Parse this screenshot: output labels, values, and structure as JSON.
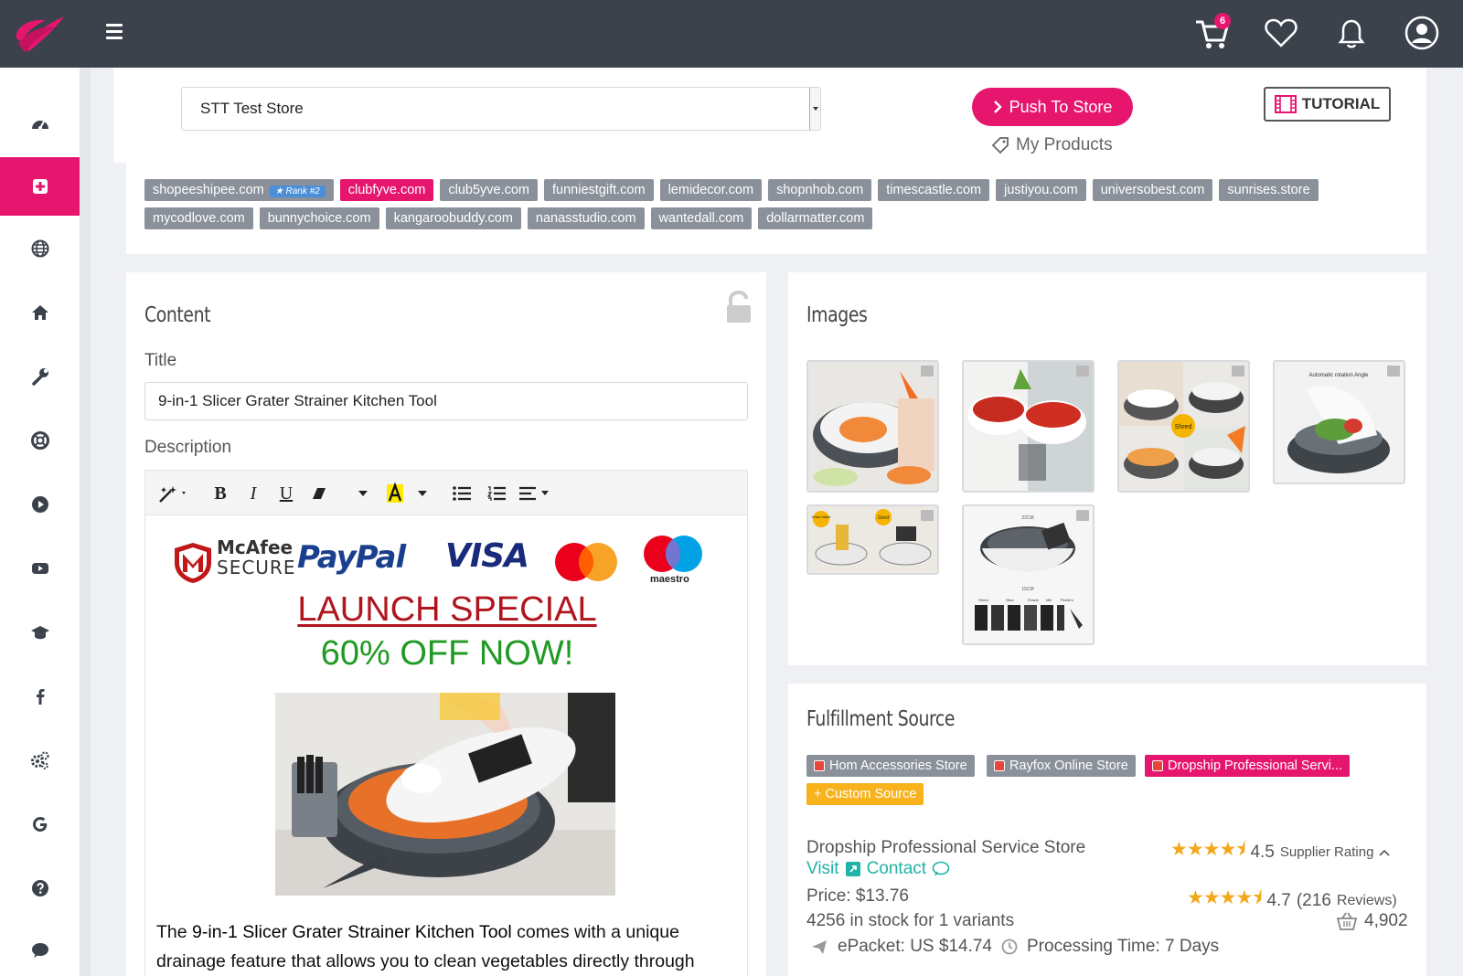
{
  "header": {
    "cart_count": "6",
    "icons": [
      "menu-icon",
      "cart-icon",
      "heart-icon",
      "bell-icon",
      "user-icon"
    ]
  },
  "sidebar": {
    "items": [
      {
        "icon": "dashboard-icon"
      },
      {
        "icon": "import-icon",
        "active": true
      },
      {
        "icon": "globe-icon"
      },
      {
        "icon": "home-icon"
      },
      {
        "icon": "wrench-icon"
      },
      {
        "icon": "support-icon"
      },
      {
        "icon": "play-icon"
      },
      {
        "icon": "youtube-icon"
      },
      {
        "icon": "graduation-cap-icon"
      },
      {
        "icon": "facebook-icon"
      },
      {
        "icon": "settings-icon"
      },
      {
        "icon": "google-icon"
      },
      {
        "icon": "help-icon"
      },
      {
        "icon": "chat-icon"
      }
    ],
    "accent": "#e6166f"
  },
  "store_bar": {
    "store_select": "STT Test Store",
    "push_label": "Push To Store",
    "my_products_label": "My Products",
    "tutorial_label": "TUTORIAL"
  },
  "domains": {
    "row1": [
      "shopeeshipee.com",
      "clubfyve.com",
      "club5yve.com",
      "funniestgift.com",
      "lemidecor.com",
      "shopnhob.com",
      "timescastle.com",
      "justiyou.com",
      "universobest.com",
      "sunrises.store"
    ],
    "row2": [
      "mycodlove.com",
      "bunnychoice.com",
      "kangaroobuddy.com",
      "nanasstudio.com",
      "wantedall.com",
      "dollarmatter.com"
    ],
    "rank_label": "Rank #2",
    "active": "clubfyve.com"
  },
  "content": {
    "heading": "Content",
    "title_label": "Title",
    "title_value": "9-in-1 Slicer Grater Strainer Kitchen Tool",
    "description_label": "Description",
    "logos": {
      "mcafee_line1": "McAfee",
      "mcafee_line2": "SECURE",
      "paypal": "PayPal",
      "visa": "VISA",
      "maestro": "maestro"
    },
    "launch_line1": "LAUNCH SPECIAL",
    "launch_line2": "60% OFF NOW!",
    "desc_prefix": "The ",
    "desc_bold": "9-in-1 Slicer Grater Strainer Kitchen Tool",
    "desc_suffix": " comes with a unique drainage feature that allows you to clean vegetables directly through",
    "colors": {
      "launch_red": "#b0151e",
      "launch_green": "#1f9a22"
    }
  },
  "images": {
    "heading": "Images",
    "thumb_texts": [
      "Shred",
      "Automatic rotation Angle",
      "Grate blade",
      "Grind",
      "22CM",
      "15CM",
      "Shred",
      "Slice",
      "Flower",
      "Mill",
      "Peelers"
    ]
  },
  "fulfillment": {
    "heading": "Fulfillment Source",
    "sources": [
      "Hom Accessories Store",
      "Rayfox Online Store",
      "Dropship Professional Servi..."
    ],
    "custom_source": "+ Custom Source",
    "store_name": "Dropship Professional Service Store",
    "supplier_rating": "4.5",
    "supplier_rating_label": "Supplier Rating",
    "visit_label": "Visit",
    "contact_label": "Contact",
    "product_rating": "4.7",
    "reviews_count": "(216",
    "reviews_label": "Reviews)",
    "price": "Price: $13.76",
    "stock": "4256 in stock for 1 variants",
    "orders": "4,902",
    "shipping": "ePacket: US $14.74",
    "processing": "Processing Time: 7 Days"
  }
}
